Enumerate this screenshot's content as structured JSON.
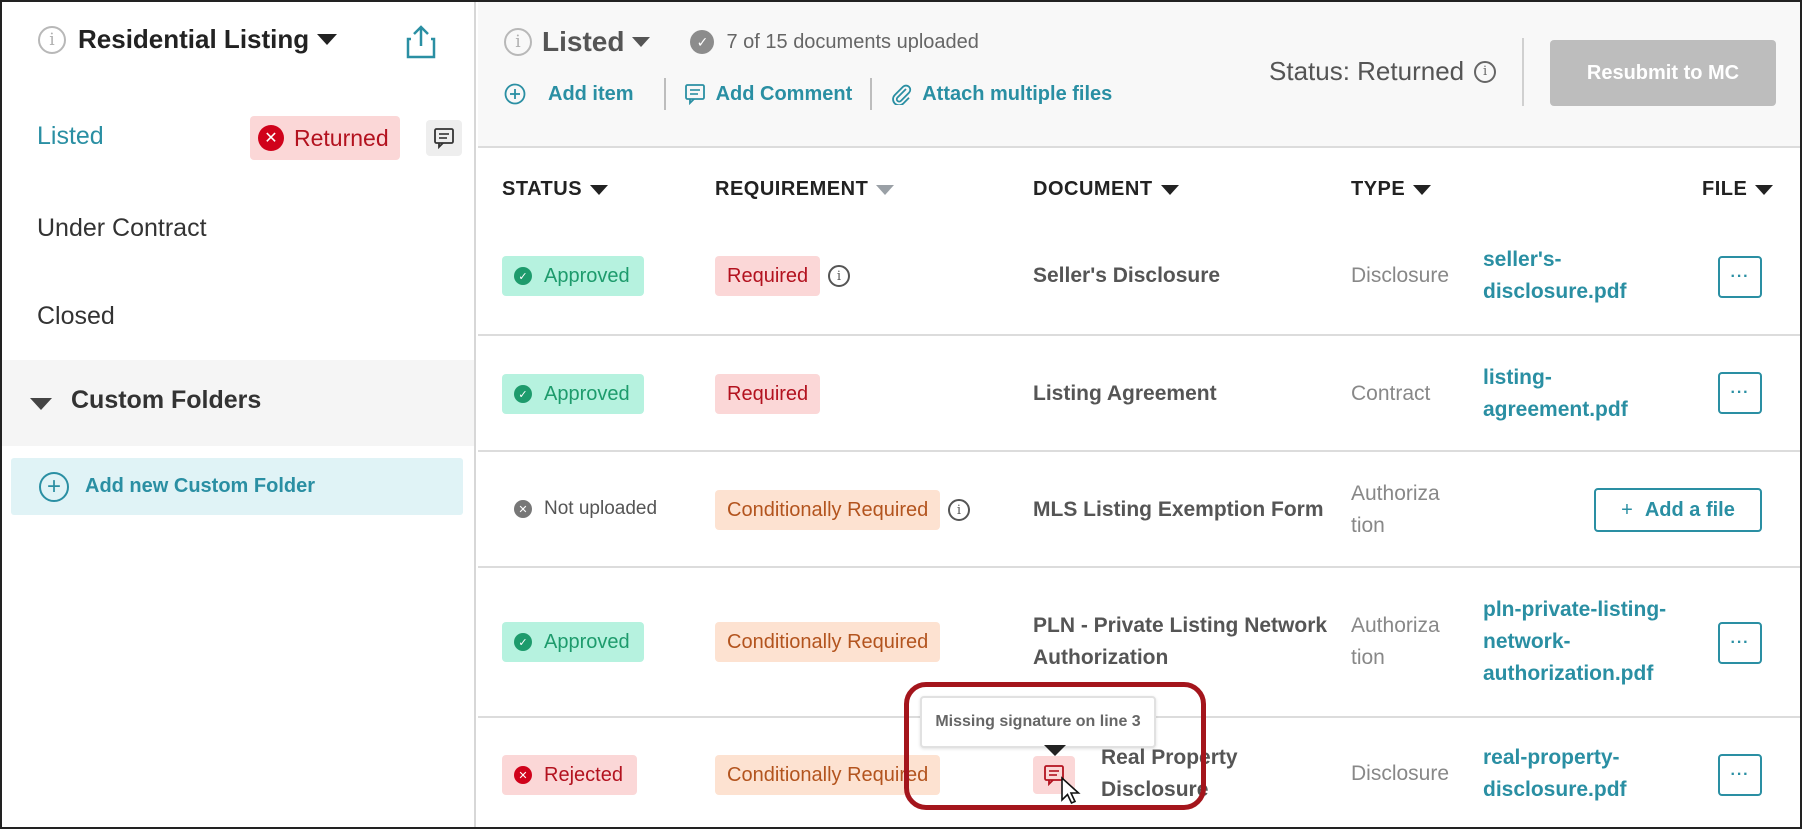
{
  "sidebar": {
    "title": "Residential Listing",
    "items": [
      {
        "label": "Listed"
      },
      {
        "label": "Under Contract"
      },
      {
        "label": "Closed"
      }
    ],
    "listed_badge": "Returned",
    "custom_folders_label": "Custom Folders",
    "add_folder_label": "Add new Custom Folder"
  },
  "header": {
    "stage": "Listed",
    "docs_count": "7 of 15 documents uploaded",
    "actions": {
      "add_item": "Add item",
      "add_comment": "Add Comment",
      "attach_files": "Attach multiple files"
    },
    "status": "Status: Returned",
    "resubmit_label": "Resubmit to MC"
  },
  "table": {
    "columns": [
      "STATUS",
      "REQUIREMENT",
      "DOCUMENT",
      "TYPE",
      "FILE"
    ],
    "rows": [
      {
        "status": "Approved",
        "requirement": "Required",
        "document": "Seller's Disclosure",
        "type": "Disclosure",
        "file_lines": [
          "seller's-",
          "disclosure.pdf"
        ],
        "more": "···"
      },
      {
        "status": "Approved",
        "requirement": "Required",
        "document": "Listing Agreement",
        "type": "Contract",
        "file_lines": [
          "listing-",
          "agreement.pdf"
        ],
        "more": "···"
      },
      {
        "status": "Not uploaded",
        "requirement": "Conditionally Required",
        "document": "MLS Listing Exemption Form",
        "type_lines": [
          "Authoriza",
          "tion"
        ],
        "add_file": "Add a file"
      },
      {
        "status": "Approved",
        "requirement": "Conditionally Required",
        "document_lines": [
          "PLN - Private Listing Network",
          "Authorization"
        ],
        "type_lines": [
          "Authoriza",
          "tion"
        ],
        "file_lines": [
          "pln-private-listing-",
          "network-",
          "authorization.pdf"
        ],
        "more": "···"
      },
      {
        "status": "Rejected",
        "requirement": "Conditionally Required",
        "document_lines": [
          "Real Property",
          "Disclosure"
        ],
        "type": "Disclosure",
        "file_lines": [
          "real-property-",
          "disclosure.pdf"
        ],
        "more": "···"
      }
    ]
  },
  "tooltip": "Missing signature on line 3",
  "colors": {
    "accent": "#2a8fa3",
    "approved": "#1d9b6c",
    "rejected": "#d0021b",
    "highlight": "#a4151c"
  }
}
